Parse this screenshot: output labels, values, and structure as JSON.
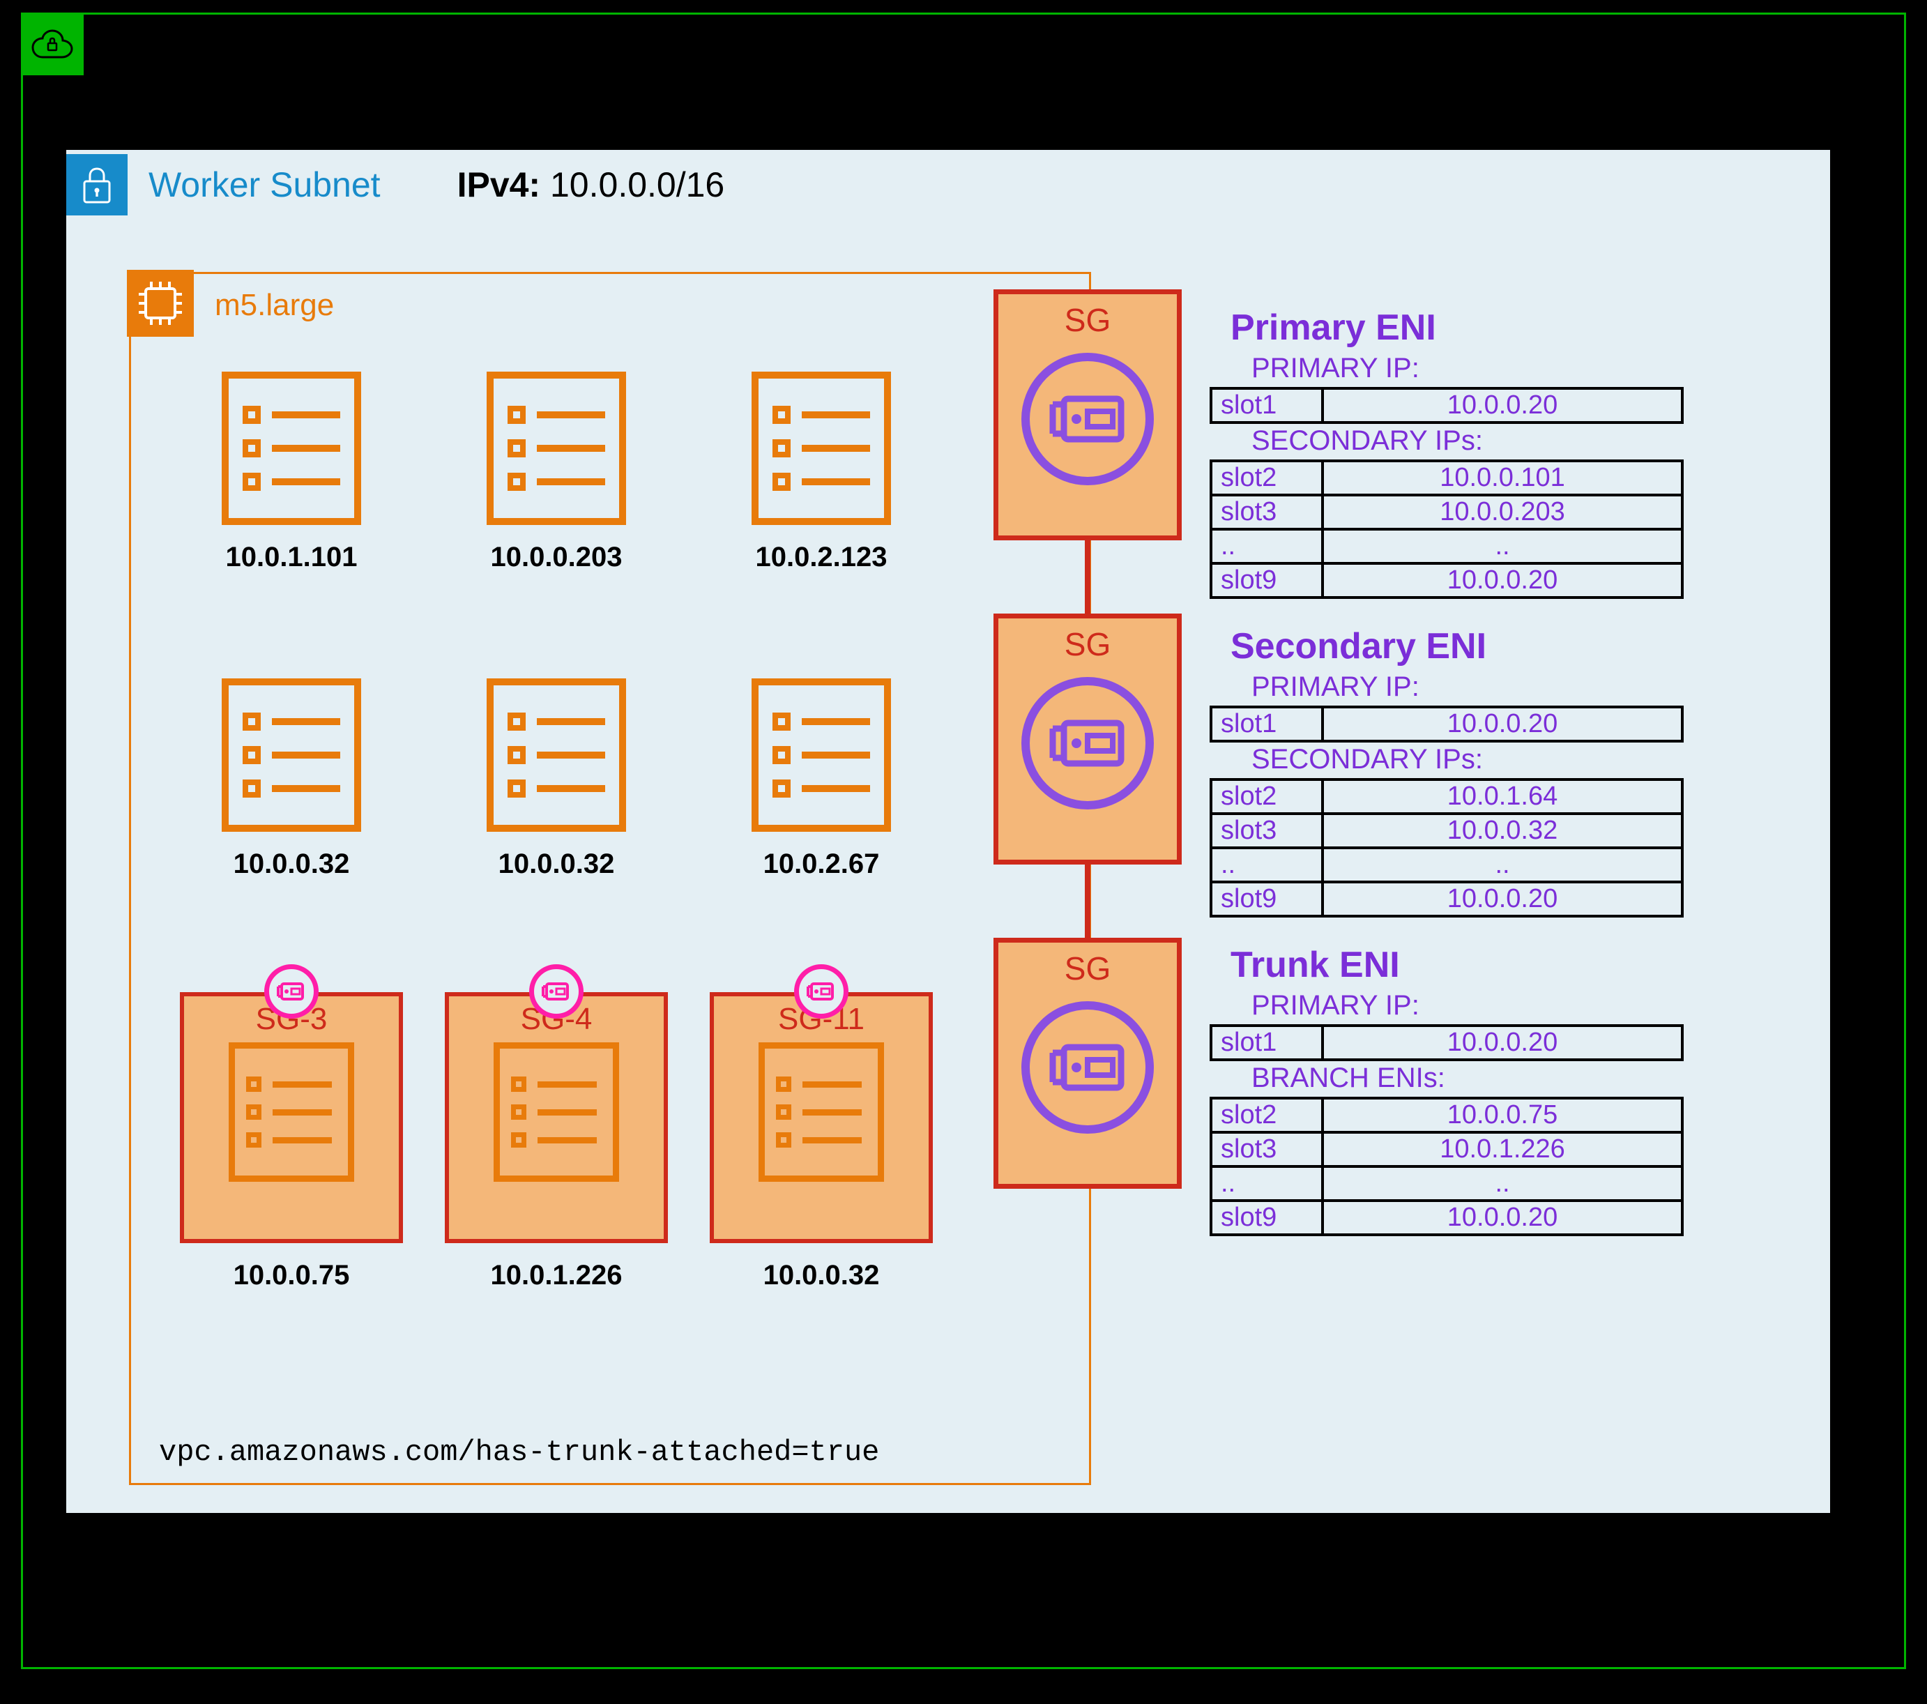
{
  "subnet": {
    "title": "Worker Subnet",
    "ipv4_label": "IPv4:",
    "ipv4_cidr": "10.0.0.0/16"
  },
  "instance": {
    "type": "m5.large",
    "footer": "vpc.amazonaws.com/has-trunk-attached=true"
  },
  "pods_row1": [
    {
      "ip": "10.0.1.101"
    },
    {
      "ip": "10.0.0.203"
    },
    {
      "ip": "10.0.2.123"
    }
  ],
  "pods_row2": [
    {
      "ip": "10.0.0.32"
    },
    {
      "ip": "10.0.0.32"
    },
    {
      "ip": "10.0.2.67"
    }
  ],
  "sg_pods": [
    {
      "sg": "SG-3",
      "ip": "10.0.0.75"
    },
    {
      "sg": "SG-4",
      "ip": "10.0.1.226"
    },
    {
      "sg": "SG-11",
      "ip": "10.0.0.32"
    }
  ],
  "eni_sg_label": "SG",
  "enis": {
    "primary": {
      "title": "Primary ENI",
      "primary_label": "PRIMARY IP:",
      "primary": {
        "slot": "slot1",
        "ip": "10.0.0.20"
      },
      "secondary_label": "SECONDARY IPs:",
      "rows": [
        {
          "slot": "slot2",
          "ip": "10.0.0.101"
        },
        {
          "slot": "slot3",
          "ip": "10.0.0.203"
        },
        {
          "slot": "..",
          "ip": ".."
        },
        {
          "slot": "slot9",
          "ip": "10.0.0.20"
        }
      ]
    },
    "secondary": {
      "title": "Secondary ENI",
      "primary_label": "PRIMARY IP:",
      "primary": {
        "slot": "slot1",
        "ip": "10.0.0.20"
      },
      "secondary_label": "SECONDARY IPs:",
      "rows": [
        {
          "slot": "slot2",
          "ip": "10.0.1.64"
        },
        {
          "slot": "slot3",
          "ip": "10.0.0.32"
        },
        {
          "slot": "..",
          "ip": ".."
        },
        {
          "slot": "slot9",
          "ip": "10.0.0.20"
        }
      ]
    },
    "trunk": {
      "title": "Trunk ENI",
      "primary_label": "PRIMARY IP:",
      "primary": {
        "slot": "slot1",
        "ip": "10.0.0.20"
      },
      "secondary_label": "BRANCH ENIs:",
      "rows": [
        {
          "slot": "slot2",
          "ip": "10.0.0.75"
        },
        {
          "slot": "slot3",
          "ip": "10.0.1.226"
        },
        {
          "slot": "..",
          "ip": ".."
        },
        {
          "slot": "slot9",
          "ip": "10.0.0.20"
        }
      ]
    }
  }
}
